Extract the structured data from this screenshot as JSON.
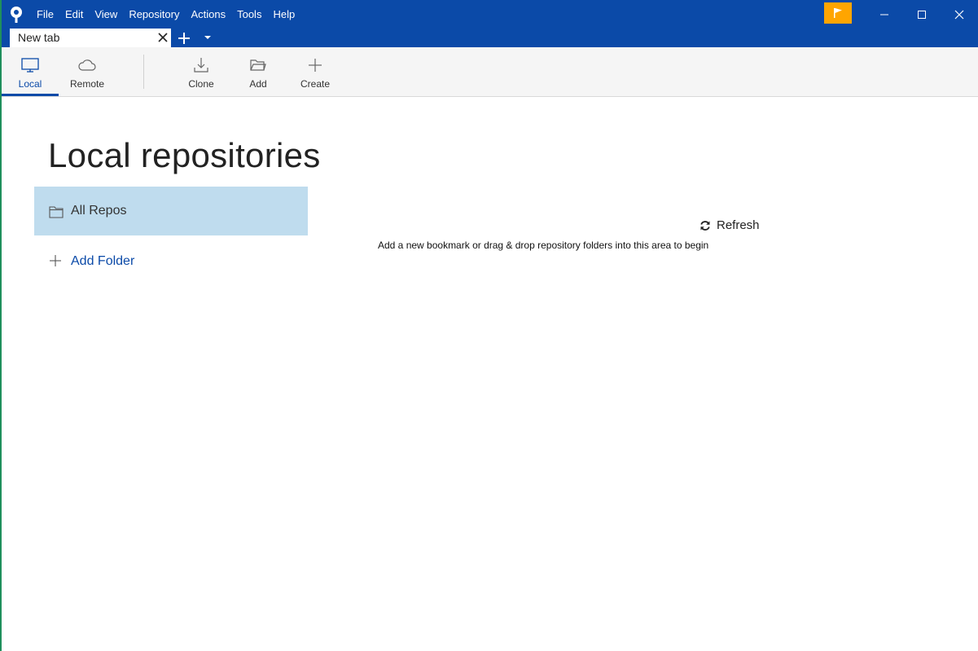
{
  "menubar": {
    "items": [
      "File",
      "Edit",
      "View",
      "Repository",
      "Actions",
      "Tools",
      "Help"
    ]
  },
  "icons": {
    "app_logo": "sourcetree-logo-icon",
    "flag": "flag-icon",
    "minimize": "minimize-icon",
    "maximize": "maximize-icon",
    "close": "close-icon"
  },
  "colors": {
    "titlebar": "#0b4aa8",
    "flag_button": "#ffa500",
    "selected_row": "#bfdcee",
    "accent": "#0b4aa8"
  },
  "tabs": {
    "active_title": "New tab"
  },
  "toolbar": {
    "local_label": "Local",
    "remote_label": "Remote",
    "clone_label": "Clone",
    "add_label": "Add",
    "create_label": "Create",
    "selected": "Local"
  },
  "main": {
    "title": "Local repositories",
    "all_repos_label": "All Repos",
    "add_folder_label": "Add Folder",
    "refresh_label": "Refresh",
    "hint": "Add a new bookmark or drag & drop repository folders into this area to begin"
  }
}
